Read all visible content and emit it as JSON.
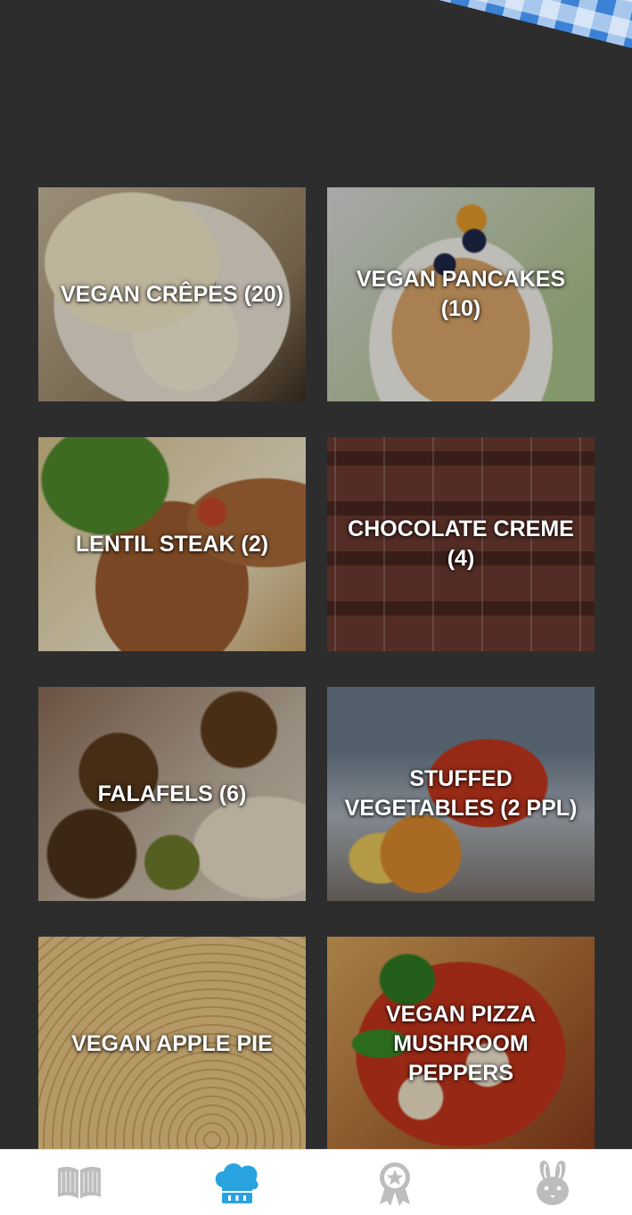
{
  "theme": {
    "background": "#2d2d2d",
    "accent": "#29a3e0",
    "nav_inactive": "#b8b8b8",
    "gingham": "#3b82d6"
  },
  "recipes": [
    {
      "label": "VEGAN CRÊPES (20)",
      "photo": "crepes"
    },
    {
      "label": "VEGAN PANCAKES (10)",
      "photo": "pancakes"
    },
    {
      "label": "LENTIL STEAK (2)",
      "photo": "lentil-steak"
    },
    {
      "label": "CHOCOLATE CREME (4)",
      "photo": "chocolate-creme"
    },
    {
      "label": "FALAFELS (6)",
      "photo": "falafels"
    },
    {
      "label": "STUFFED VEGETABLES (2 PPL)",
      "photo": "stuffed-vegetables"
    },
    {
      "label": "VEGAN APPLE PIE",
      "photo": "apple-pie"
    },
    {
      "label": "VEGAN PIZZA MUSHROOM PEPPERS",
      "photo": "pizza"
    }
  ],
  "bottom_nav": [
    {
      "icon": "book-icon",
      "active": false
    },
    {
      "icon": "chef-hat-icon",
      "active": true
    },
    {
      "icon": "award-ribbon-icon",
      "active": false
    },
    {
      "icon": "rabbit-icon",
      "active": false
    }
  ]
}
